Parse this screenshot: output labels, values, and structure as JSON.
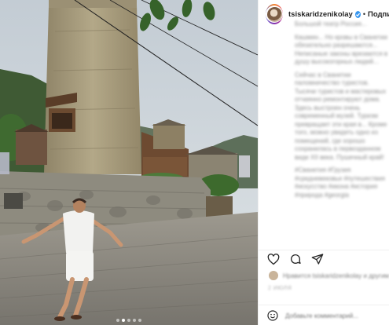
{
  "post": {
    "username": "tsiskaridzenikolay",
    "header_separator": "•",
    "follow_label": "Подписаться",
    "icons": {
      "verified": "verified-badge-icon",
      "like": "heart-icon",
      "comment": "comment-icon",
      "share": "paper-plane-icon",
      "emoji": "smiley-icon"
    },
    "colors": {
      "verified": "#3897f0",
      "text": "#262626",
      "muted": "#8e8e8e",
      "border": "#efefef"
    },
    "caption": [
      "Большой театр Россия...",
      "Кашмин... Но кровы в Сванетии обязательно разрешаются... Неписаные законы врезаются в душу высокогорных людей...",
      "Сейчас в Сванетии паломничество туристов. Тысячи туристов и мастеровых отчаянно ремонтируют дома. Здесь выстроен очень современный музей. Туризм превращает эти края в... Кроме того, можно увидеть одно из помещений, где хорошо сохранилась в первозданном виде XII века. Пушечный край!",
      "#Сванетия #Грузия #средневековье #путешествия #искусство #икона #история #природа #georgia"
    ],
    "likes_text": "Нравится tsiskaridzenikolay и другим",
    "date_text": "2 ИЮЛЯ",
    "comment_placeholder": "Добавьте комментарий...",
    "carousel": {
      "count": 5,
      "active_index": 1
    }
  }
}
